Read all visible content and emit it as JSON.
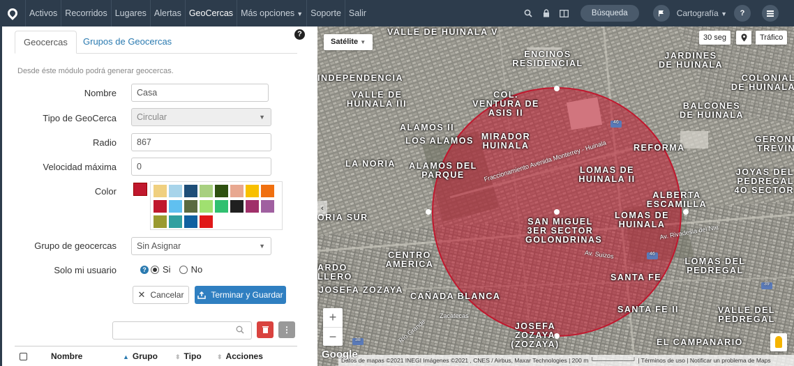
{
  "nav": {
    "items": [
      {
        "label": "Activos"
      },
      {
        "label": "Recorridos"
      },
      {
        "label": "Lugares"
      },
      {
        "label": "Alertas"
      },
      {
        "label": "GeoCercas",
        "active": true
      },
      {
        "label": "Más opciones",
        "dropdown": true
      },
      {
        "label": "Soporte"
      },
      {
        "label": "Salir"
      }
    ],
    "search_label": "Búsqueda",
    "cartography_label": "Cartografía"
  },
  "panel": {
    "tabs": [
      "Geocercas",
      "Grupos de Geocercas"
    ],
    "intro": "Desde éste módulo podrá generar geocercas.",
    "form": {
      "name_label": "Nombre",
      "name_value": "Casa",
      "type_label": "Tipo de GeoCerca",
      "type_value": "Circular",
      "radius_label": "Radio",
      "radius_value": "867",
      "speed_label": "Velocidad máxima",
      "speed_value": "0",
      "color_label": "Color",
      "selected_color": "#c0182e",
      "palette": [
        "#f0d080",
        "#a8d4ea",
        "#1e4e78",
        "#a8d080",
        "#2e5010",
        "#e8a890",
        "#f8c000",
        "#f07010",
        "#c0182e",
        "#60c0f0",
        "#5a6a40",
        "#a0e070",
        "#30c070",
        "#202020",
        "#a0306a",
        "#a060a0",
        "#9a9a30",
        "#30a0a0",
        "#1060a0",
        "#e01818"
      ],
      "group_label": "Grupo de geocercas",
      "group_value": "Sin Asignar",
      "own_user_label": "Solo mi usuario",
      "yes_label": "Si",
      "no_label": "No",
      "cancel_label": "Cancelar",
      "save_label": "Terminar y Guardar"
    },
    "table": {
      "headers": [
        "Nombre",
        "Grupo",
        "Tipo",
        "Acciones"
      ]
    }
  },
  "map": {
    "type_label": "Satélite",
    "refresh_label": "30 seg",
    "traffic_label": "Tráfico",
    "google_label": "Google",
    "attribution": "Datos de mapas ©2021 INEGI Imágenes ©2021 , CNES / Airbus, Maxar Technologies | 200 m └─────────┘ | Términos de uso | Notificar un problema de Maps",
    "geofence_color": "#c0182e",
    "places": [
      "VALLE DE HUINALA V",
      "ENCINOS RESIDENCIAL",
      "JARDINES DE HUINALA",
      "INDEPENDENCIA",
      "VALLE DE HUINALA III",
      "COL. VENTURA DE ASIS II",
      "COLONIAL DE HUINALA",
      "BALCONES DE HUINALA",
      "ALAMOS II",
      "MIRADOR HUINALA",
      "LOS ALAMOS",
      "REFORMA",
      "GERONI TREVIN",
      "LA NORIA",
      "ALAMOS DEL PARQUE",
      "LOMAS DE HUINALA II",
      "JOYAS DEL PEDREGAL 4O SECTOR",
      "ALBERTA ESCAMILLA",
      "LOMAS DE HUINALA",
      "ORIA SUR",
      "SAN MIGUEL 3ER SECTOR GOLONDRINAS",
      "CENTRO AMERICA",
      "LOMAS DEL PEDREGAL",
      "ARDO LLERO",
      "SANTA FE",
      "JOSEFA ZOZAYA",
      "CAÑADA BLANCA",
      "SANTA FE II",
      "VALLE DEL PEDREGAL",
      "JOSEFA ZOZAYA (ZOZAYA)",
      "EL CAMPANARIO"
    ],
    "roads": [
      "Fraccionamiento Avenida Monterrey - Huinala",
      "Av. Rivadesia del Nte",
      "Av. Suizos",
      "Zacatecas",
      "Río Grande",
      "46",
      "46",
      "39",
      "38"
    ]
  }
}
